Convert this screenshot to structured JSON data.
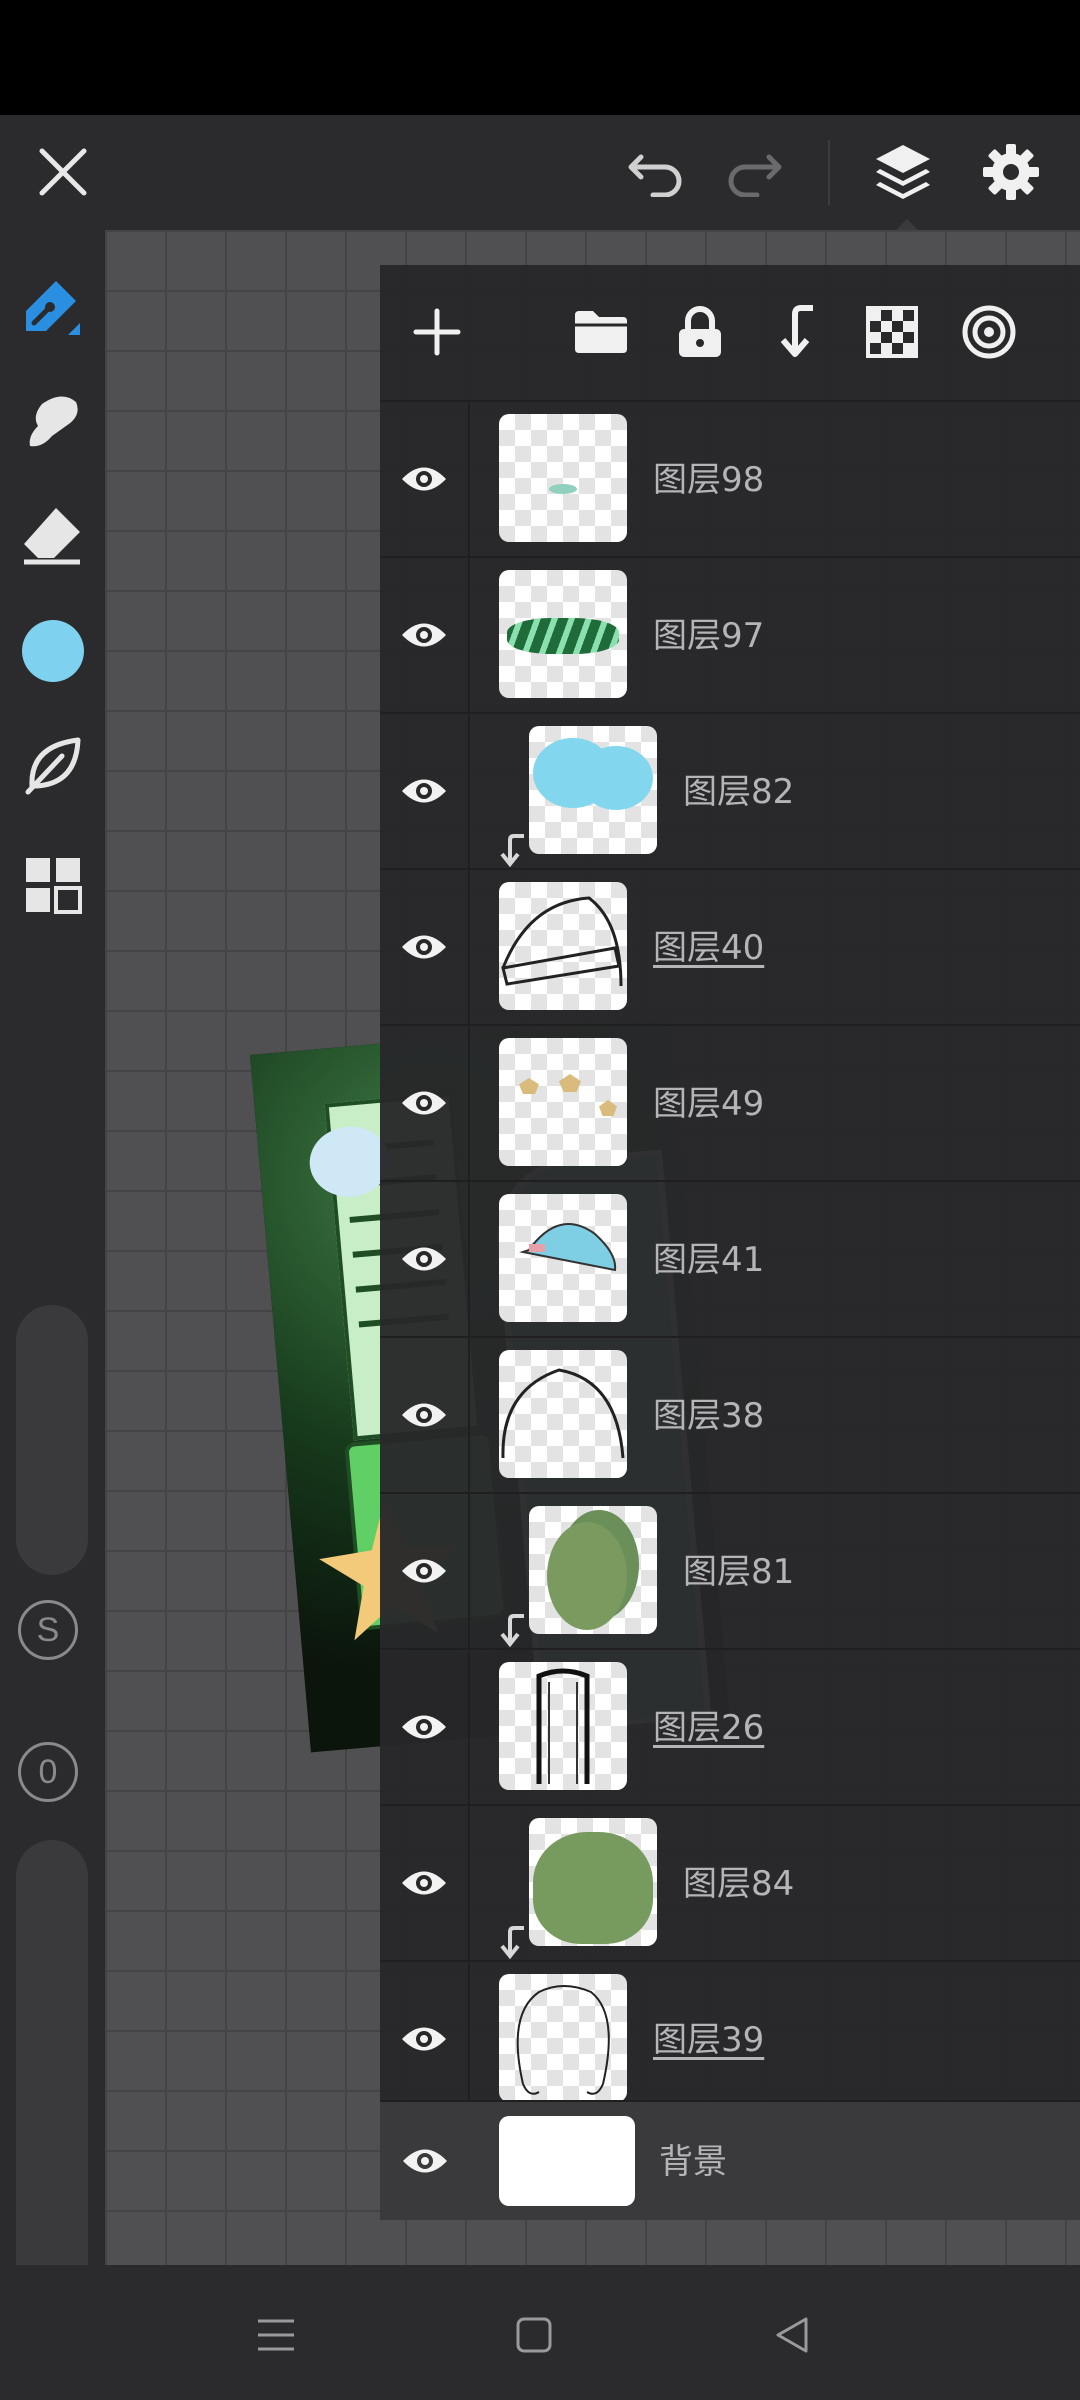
{
  "accent_color": "#2a8fe0",
  "brush_color": "#7fd2ef",
  "toolbar": {
    "close_icon": "close-icon",
    "undo_icon": "undo-icon",
    "redo_icon": "redo-icon",
    "layers_icon": "layers-icon",
    "settings_icon": "gear-icon"
  },
  "left_tools": [
    {
      "name": "pen-tool-icon"
    },
    {
      "name": "smudge-tool-icon"
    },
    {
      "name": "eraser-tool-icon"
    },
    {
      "name": "color-swatch"
    },
    {
      "name": "leaf-tool-icon"
    },
    {
      "name": "grid-menu-icon"
    }
  ],
  "sliders": {
    "size_badge": "S",
    "opacity_badge": "0"
  },
  "layers_panel": {
    "actions": [
      "add-layer-icon",
      "folder-icon",
      "lock-icon",
      "merge-down-icon",
      "transparency-icon",
      "target-icon"
    ],
    "layers": [
      {
        "name": "图层98",
        "underlined": false,
        "clipped": false,
        "thumb": "teal-smudge"
      },
      {
        "name": "图层97",
        "underlined": false,
        "clipped": false,
        "thumb": "green-hat-band"
      },
      {
        "name": "图层82",
        "underlined": false,
        "clipped": true,
        "thumb": "blue-blob"
      },
      {
        "name": "图层40",
        "underlined": true,
        "clipped": false,
        "thumb": "hat-outline"
      },
      {
        "name": "图层49",
        "underlined": false,
        "clipped": false,
        "thumb": "stars-scatter"
      },
      {
        "name": "图层41",
        "underlined": false,
        "clipped": false,
        "thumb": "blue-hat"
      },
      {
        "name": "图层38",
        "underlined": false,
        "clipped": false,
        "thumb": "head-arc"
      },
      {
        "name": "图层81",
        "underlined": false,
        "clipped": true,
        "thumb": "green-oval"
      },
      {
        "name": "图层26",
        "underlined": true,
        "clipped": false,
        "thumb": "rect-frame"
      },
      {
        "name": "图层84",
        "underlined": false,
        "clipped": true,
        "thumb": "green-cloud"
      },
      {
        "name": "图层39",
        "underlined": true,
        "clipped": false,
        "thumb": "body-outline"
      }
    ],
    "background_layer": {
      "name": "背景"
    }
  },
  "nav": {
    "menu_icon": "menu-icon",
    "home_icon": "home-icon",
    "back_icon": "back-icon"
  }
}
